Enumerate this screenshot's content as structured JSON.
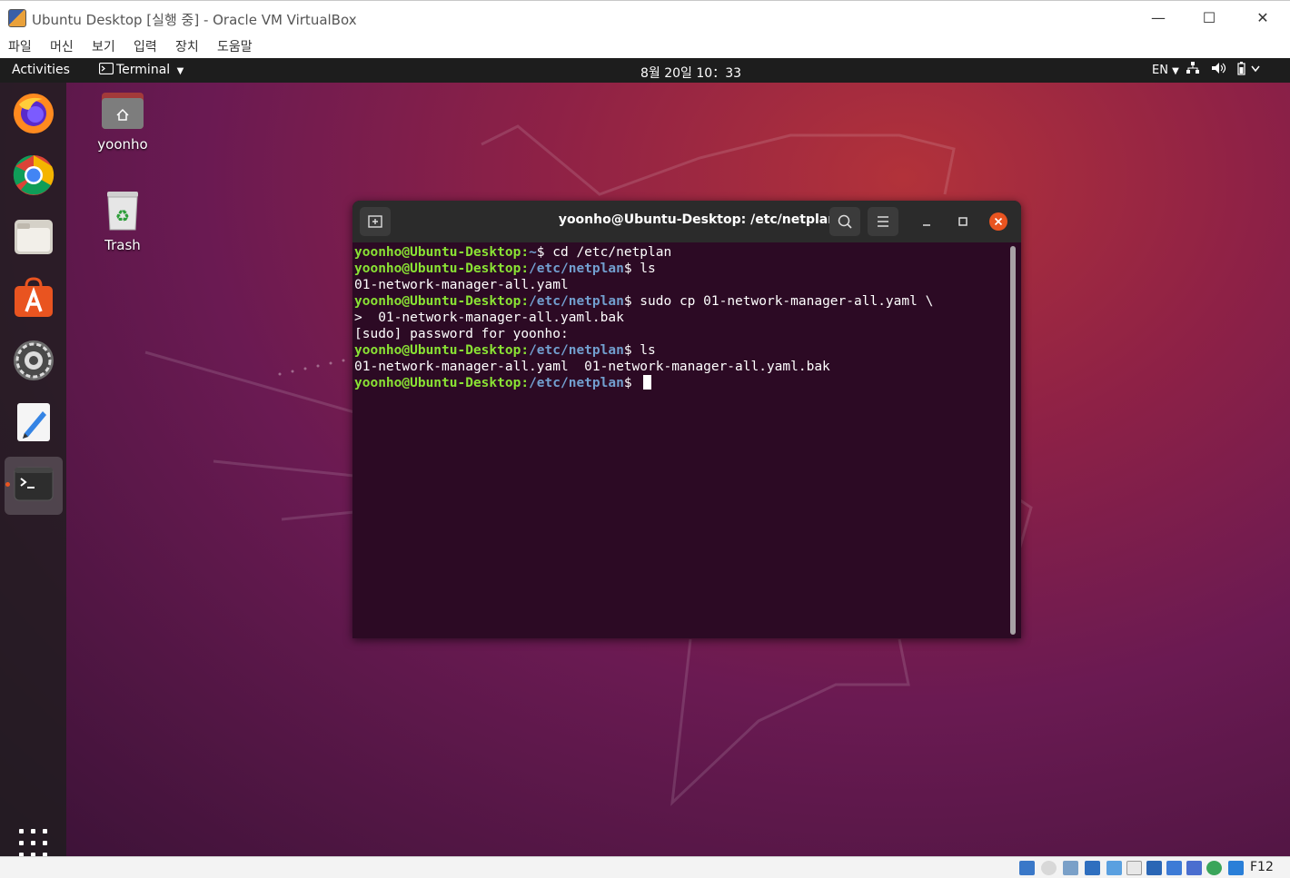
{
  "host": {
    "title": "Ubuntu Desktop [실행 중] - Oracle VM VirtualBox",
    "menu": [
      "파일",
      "머신",
      "보기",
      "입력",
      "장치",
      "도움말"
    ],
    "hostkey": "F12",
    "window_controls": {
      "minimize": "—",
      "maximize": "☐",
      "close": "✕"
    }
  },
  "topbar": {
    "activities": "Activities",
    "app_menu": "Terminal",
    "clock": "8월 20일  10：33",
    "lang": "EN"
  },
  "desktop": {
    "home_label": "yoonho",
    "trash_label": "Trash"
  },
  "dock": {
    "items": [
      "firefox-icon",
      "chrome-icon",
      "files-icon",
      "software-icon",
      "settings-icon",
      "text-editor-icon",
      "terminal-icon"
    ]
  },
  "terminal": {
    "title": "yoonho@Ubuntu-Desktop: /etc/netplan",
    "prompt_user": "yoonho@Ubuntu-Desktop",
    "lines": [
      {
        "type": "prompt",
        "path": "~",
        "cmd": "cd /etc/netplan"
      },
      {
        "type": "prompt",
        "path": "/etc/netplan",
        "cmd": "ls"
      },
      {
        "type": "output",
        "text": "01-network-manager-all.yaml"
      },
      {
        "type": "prompt",
        "path": "/etc/netplan",
        "cmd": "sudo cp 01-network-manager-all.yaml \\"
      },
      {
        "type": "output",
        "text": ">  01-network-manager-all.yaml.bak"
      },
      {
        "type": "output",
        "text": "[sudo] password for yoonho:"
      },
      {
        "type": "prompt",
        "path": "/etc/netplan",
        "cmd": "ls"
      },
      {
        "type": "output",
        "text": "01-network-manager-all.yaml  01-network-manager-all.yaml.bak"
      },
      {
        "type": "prompt",
        "path": "/etc/netplan",
        "cmd": ""
      }
    ]
  },
  "colors": {
    "prompt_user": "#8ae234",
    "prompt_path": "#729fcf",
    "terminal_bg": "#2c0a24",
    "accent": "#e95420"
  }
}
